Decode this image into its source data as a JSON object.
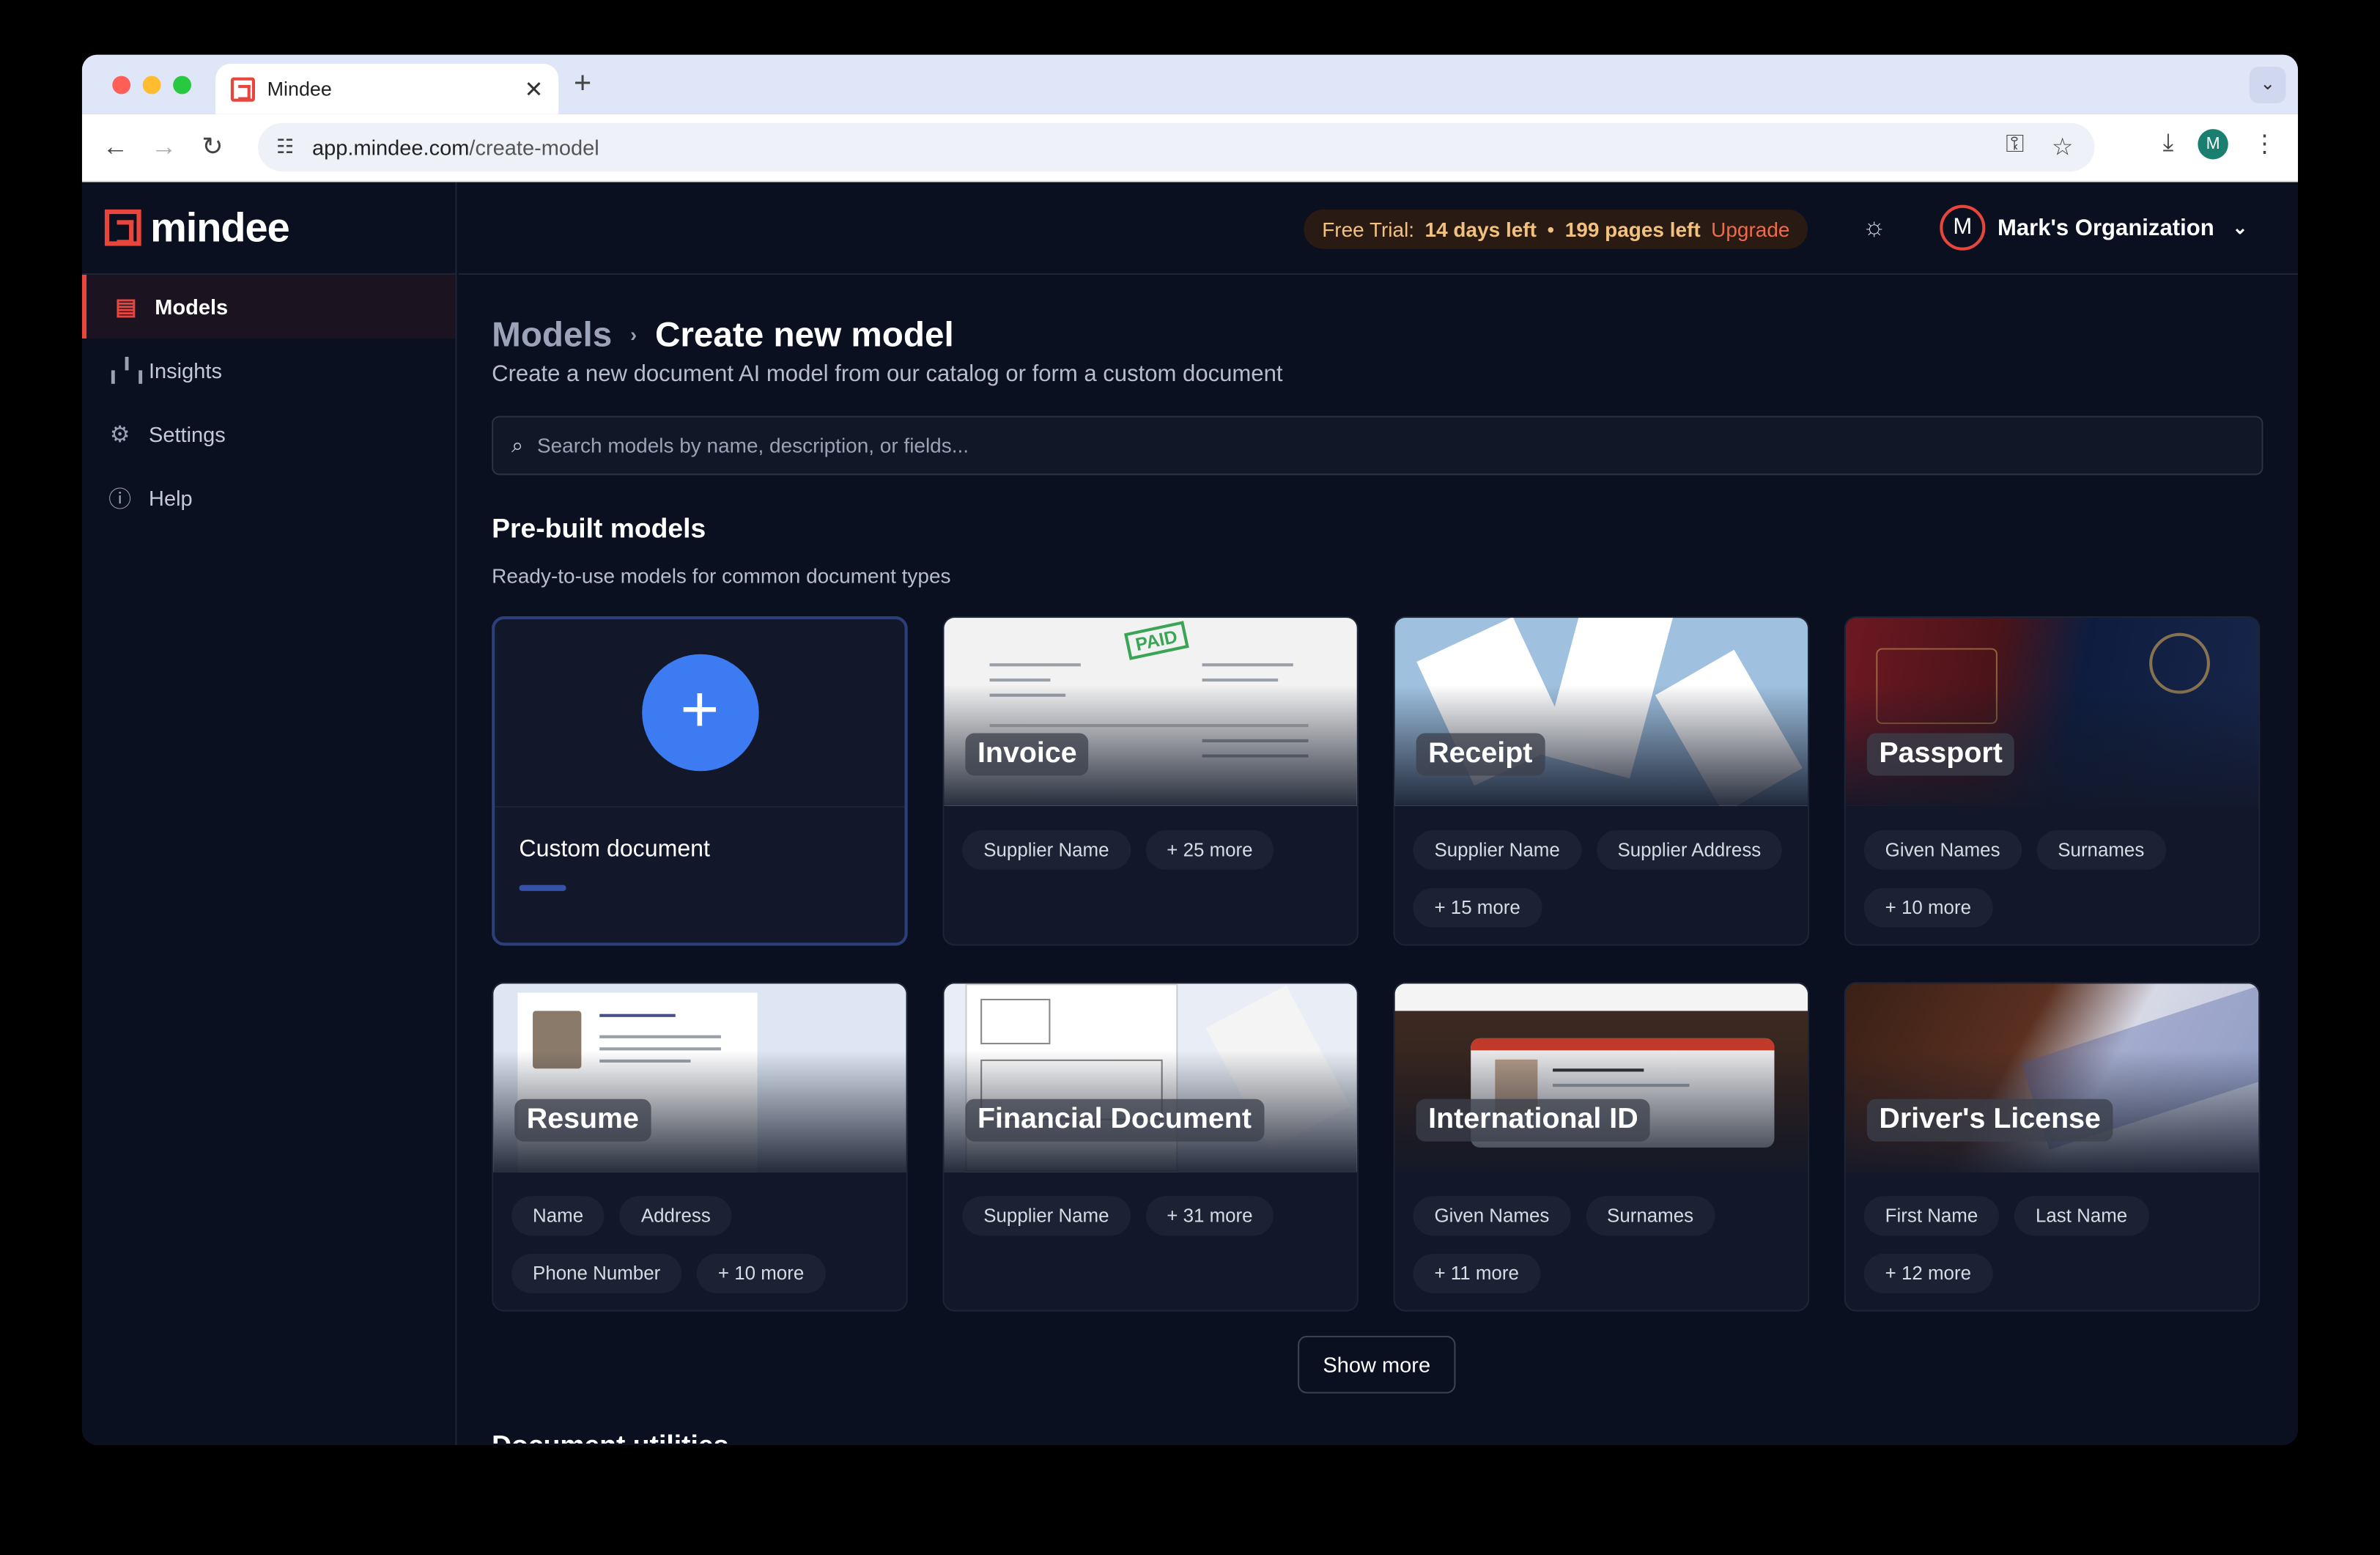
{
  "browser": {
    "tab_title": "Mindee",
    "url_host": "app.mindee.com",
    "url_path": "/create-model",
    "profile_initial": "M"
  },
  "app": {
    "logo_text": "mindee",
    "sidebar": [
      {
        "label": "Models",
        "icon": "document-icon",
        "active": true
      },
      {
        "label": "Insights",
        "icon": "bar-chart-icon",
        "active": false
      },
      {
        "label": "Settings",
        "icon": "gear-icon",
        "active": false
      },
      {
        "label": "Help",
        "icon": "help-circle-icon",
        "active": false
      }
    ],
    "trial": {
      "prefix": "Free Trial:",
      "days": "14 days left",
      "dot": "•",
      "pages": "199 pages left",
      "upgrade": "Upgrade"
    },
    "org": {
      "initial": "M",
      "name": "Mark's Organization"
    }
  },
  "page": {
    "breadcrumb_parent": "Models",
    "breadcrumb_current": "Create new model",
    "subtitle": "Create a new document AI model from our catalog or form a custom document",
    "search_placeholder": "Search models by name, description, or fields...",
    "section_title": "Pre-built models",
    "section_subtitle": "Ready-to-use models for common document types",
    "custom_card_label": "Custom document",
    "cards": [
      {
        "name": "Invoice",
        "chips": [
          "Supplier Name",
          "+ 25 more"
        ]
      },
      {
        "name": "Receipt",
        "chips": [
          "Supplier Name",
          "Supplier Address",
          "+ 15 more"
        ]
      },
      {
        "name": "Passport",
        "chips": [
          "Given Names",
          "Surnames",
          "+ 10 more"
        ]
      },
      {
        "name": "Resume",
        "chips": [
          "Name",
          "Address",
          "Phone Number",
          "+ 10 more"
        ]
      },
      {
        "name": "Financial Document",
        "chips": [
          "Supplier Name",
          "+ 31 more"
        ]
      },
      {
        "name": "International ID",
        "chips": [
          "Given Names",
          "Surnames",
          "+ 11 more"
        ]
      },
      {
        "name": "Driver's License",
        "chips": [
          "First Name",
          "Last Name",
          "+ 12 more"
        ]
      }
    ],
    "show_more": "Show more",
    "next_section_peek": "Document utilities"
  }
}
